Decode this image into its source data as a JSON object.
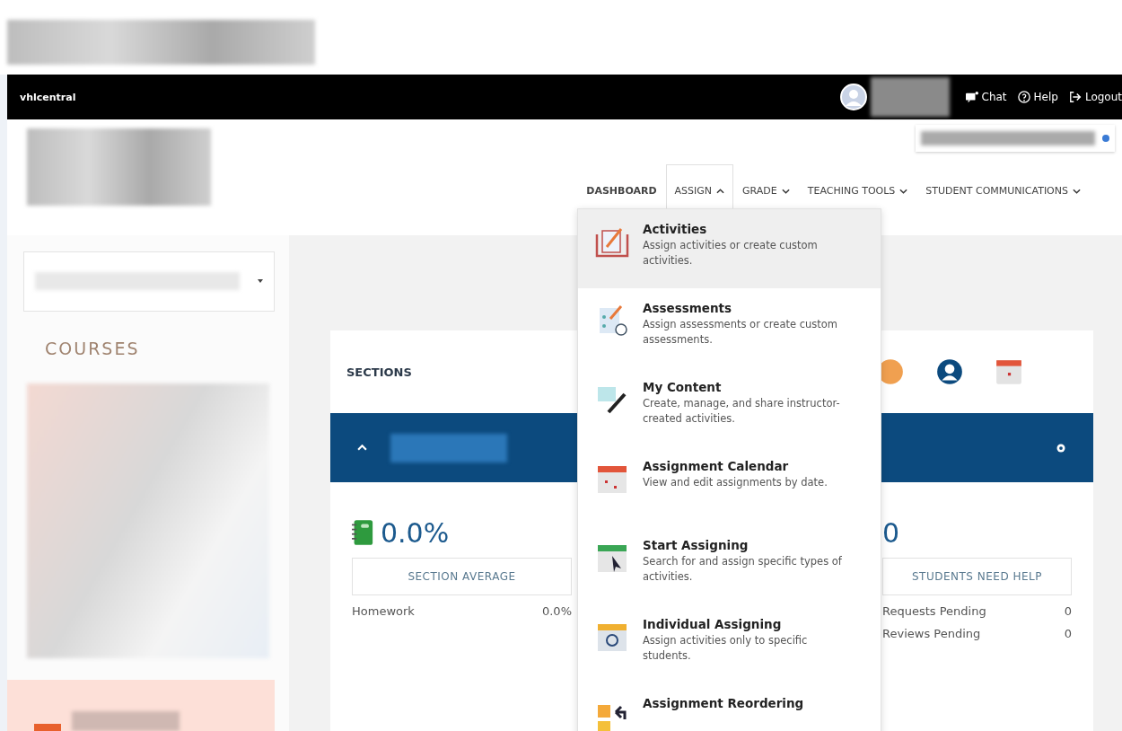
{
  "topbar": {
    "brand": "vhlcentral",
    "links": [
      {
        "kind": "chat",
        "label": "Chat"
      },
      {
        "kind": "help",
        "label": "Help"
      },
      {
        "kind": "logout",
        "label": "Logout"
      }
    ]
  },
  "nav": [
    {
      "label": "DASHBOARD",
      "kind": "link",
      "selected": true
    },
    {
      "label": "ASSIGN",
      "kind": "dropdown",
      "selected": false,
      "expanded": true
    },
    {
      "label": "GRADE",
      "kind": "dropdown",
      "selected": false,
      "expanded": false
    },
    {
      "label": "TEACHING TOOLS",
      "kind": "dropdown",
      "selected": false,
      "expanded": false
    },
    {
      "label": "STUDENT COMMUNICATIONS",
      "kind": "dropdown",
      "selected": false,
      "expanded": false
    }
  ],
  "assign_menu": [
    {
      "title": "Activities",
      "description": "Assign activities or create custom activities.",
      "selected": true
    },
    {
      "title": "Assessments",
      "description": "Assign assessments or create custom assessments.",
      "selected": false
    },
    {
      "title": "My Content",
      "description": "Create, manage, and share instructor-created activities.",
      "selected": false
    },
    {
      "title": "Assignment Calendar",
      "description": "View and edit assignments by date.",
      "selected": false
    },
    {
      "title": "Start Assigning",
      "description": "Search for and assign specific types of activities.",
      "selected": false
    },
    {
      "title": "Individual Assigning",
      "description": "Assign activities only to specific students.",
      "selected": false
    },
    {
      "title": "Assignment Reordering",
      "selected": false
    }
  ],
  "sidebar": {
    "heading": "COURSES"
  },
  "sections": {
    "title": "SECTIONS",
    "section_expanded": true,
    "stats": [
      {
        "value": "0.0%",
        "label": "SECTION AVERAGE",
        "rows": [
          {
            "name": "Homework",
            "value": "0.0%"
          }
        ]
      },
      {
        "value": "0",
        "label": "STUDENTS NEED HELP",
        "rows": [
          {
            "name": "Requests Pending",
            "value": "0"
          },
          {
            "name": "Reviews Pending",
            "value": "0"
          }
        ]
      }
    ]
  }
}
